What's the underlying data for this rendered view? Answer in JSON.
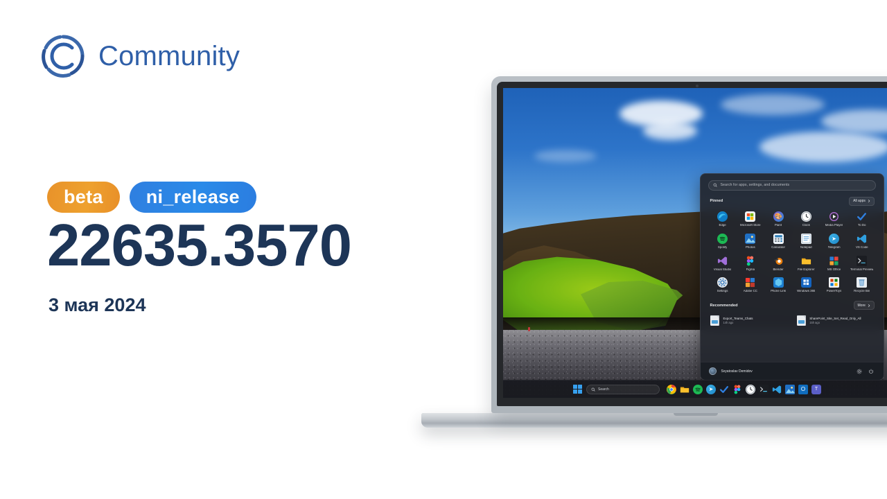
{
  "brand": {
    "name": "Community",
    "logo_icon": "community-c-ring-icon",
    "color": "#2f5fa8"
  },
  "release": {
    "badges": [
      {
        "label": "beta",
        "color": "#e8922a"
      },
      {
        "label": "ni_release",
        "color": "#2b80e3"
      }
    ],
    "build": "22635.3570",
    "date": "3 мая 2024",
    "text_color": "#1d3557"
  },
  "start_menu": {
    "search": {
      "placeholder": "Search for apps, settings, and documents",
      "icon": "search-icon"
    },
    "pinned": {
      "title": "Pinned",
      "all_apps_label": "All apps",
      "all_apps_icon": "chevron-right-icon",
      "apps": [
        {
          "label": "Edge",
          "icon": "edge-icon"
        },
        {
          "label": "Microsoft Store",
          "icon": "microsoft-store-icon"
        },
        {
          "label": "Paint",
          "icon": "paint-icon"
        },
        {
          "label": "Clock",
          "icon": "clock-icon"
        },
        {
          "label": "Media Player",
          "icon": "media-player-icon"
        },
        {
          "label": "To Do",
          "icon": "to-do-icon"
        },
        {
          "label": "Spotify",
          "icon": "spotify-icon"
        },
        {
          "label": "Photos",
          "icon": "photos-icon"
        },
        {
          "label": "Calculator",
          "icon": "calculator-icon"
        },
        {
          "label": "Notepad",
          "icon": "notepad-icon"
        },
        {
          "label": "Telegram",
          "icon": "telegram-icon"
        },
        {
          "label": "VS Code",
          "icon": "vs-code-icon"
        },
        {
          "label": "Visual Studio",
          "icon": "visual-studio-icon"
        },
        {
          "label": "Figma",
          "icon": "figma-icon"
        },
        {
          "label": "Blender",
          "icon": "blender-icon"
        },
        {
          "label": "File Explorer",
          "icon": "file-explorer-icon"
        },
        {
          "label": "MS Office",
          "icon": "ms-office-icon"
        },
        {
          "label": "Terminal Preview",
          "icon": "terminal-preview-icon"
        },
        {
          "label": "Settings",
          "icon": "settings-gear-icon"
        },
        {
          "label": "Adobe CC",
          "icon": "adobe-cc-icon"
        },
        {
          "label": "Phone Link",
          "icon": "phone-link-icon"
        },
        {
          "label": "Windows 365",
          "icon": "windows-365-icon"
        },
        {
          "label": "PowerToys",
          "icon": "powertoys-icon"
        },
        {
          "label": "Recycle Bin",
          "icon": "recycle-bin-icon"
        }
      ]
    },
    "recommended": {
      "title": "Recommended",
      "more_label": "More",
      "more_icon": "chevron-right-icon",
      "items": [
        {
          "name": "Export_Teams_Chats",
          "time": "14h ago",
          "icon": "document-file-icon"
        },
        {
          "name": "SharePoint_Site_Set_Read_Only_All",
          "time": "15h ago",
          "icon": "document-file-icon"
        }
      ]
    },
    "footer": {
      "user": "Svyatoslav Demidov",
      "avatar_icon": "user-avatar-icon",
      "settings_icon": "settings-gear-icon",
      "power_icon": "power-icon"
    }
  },
  "taskbar": {
    "start_icon": "windows-start-icon",
    "search": {
      "label": "Search",
      "icon": "search-icon"
    },
    "apps": [
      {
        "icon": "chrome-icon"
      },
      {
        "icon": "file-explorer-icon"
      },
      {
        "icon": "spotify-icon"
      },
      {
        "icon": "telegram-icon"
      },
      {
        "icon": "to-do-icon"
      },
      {
        "icon": "figma-icon"
      },
      {
        "icon": "clock-icon"
      },
      {
        "icon": "terminal-icon"
      },
      {
        "icon": "vs-code-icon"
      },
      {
        "icon": "photos-icon"
      },
      {
        "icon": "outlook-icon"
      },
      {
        "icon": "teams-icon"
      }
    ]
  },
  "wallpaper": {
    "description": "Iceland coastal cliff with green moss and black pebble beach"
  }
}
